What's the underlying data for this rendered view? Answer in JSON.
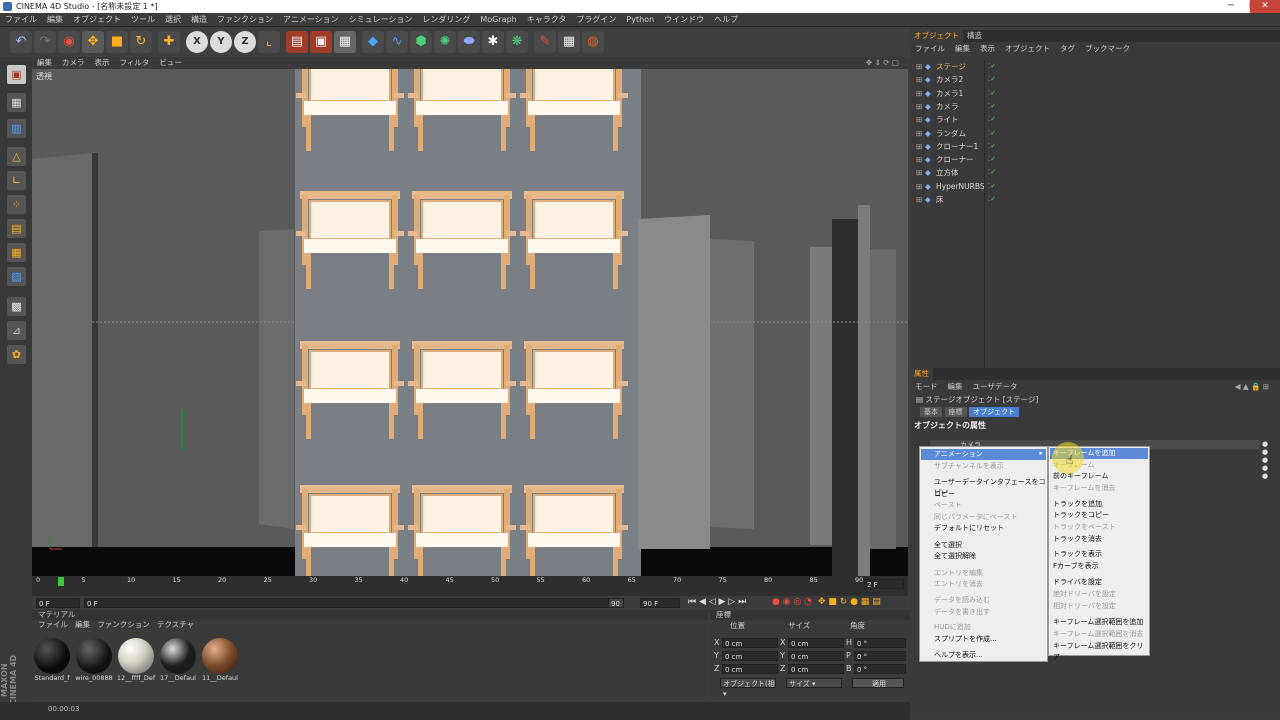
{
  "window": {
    "title": "CINEMA 4D Studio - [名称未設定 1 *]",
    "minimize": "─",
    "maximize": "□",
    "close": "✕"
  },
  "menubar": [
    "ファイル",
    "編集",
    "オブジェクト",
    "ツール",
    "選択",
    "構造",
    "ファンクション",
    "アニメーション",
    "シミュレーション",
    "レンダリング",
    "MoGraph",
    "キャラクタ",
    "プラグイン",
    "Python",
    "ウインドウ",
    "ヘルプ"
  ],
  "toolbar": {
    "icons": [
      "undo-icon",
      "redo-icon",
      "live-selection-icon",
      "move-icon",
      "scale-icon",
      "rotate-icon",
      "add-icon",
      "x-axis-icon",
      "y-axis-icon",
      "z-axis-icon",
      "coordinate-system-icon",
      "render-view-icon",
      "render-picture-viewer-icon",
      "render-settings-icon",
      "cube-icon",
      "spline-icon",
      "nurbs-icon",
      "array-icon",
      "deformer-icon",
      "scene-icon",
      "environment-icon",
      "camera-icon",
      "light-icon"
    ],
    "axis_x": "X",
    "axis_y": "Y",
    "axis_z": "Z"
  },
  "viewport": {
    "menu": [
      "編集",
      "カメラ",
      "表示",
      "フィルタ",
      "ビュー"
    ],
    "label": "透視"
  },
  "timeline": {
    "ticks": [
      "0",
      "5",
      "10",
      "15",
      "20",
      "25",
      "30",
      "35",
      "40",
      "45",
      "50",
      "55",
      "60",
      "65",
      "70",
      "75",
      "80",
      "85",
      "90"
    ],
    "end_frame": "2 F",
    "start_field": "0 F",
    "mid_field": "0 F",
    "max_field": "90 F",
    "range_field": "90 F"
  },
  "materials": {
    "title": "マテリアル",
    "menu": [
      "ファイル",
      "編集",
      "ファンクション",
      "テクスチャ"
    ],
    "items": [
      {
        "name": "Standard_f",
        "color": "#0a0a0a"
      },
      {
        "name": "wire_00888",
        "color": "#111111"
      },
      {
        "name": "12__ffff_Def",
        "color": "#d8d4c8"
      },
      {
        "name": "17__Defaul",
        "color": "#1c1c1c"
      },
      {
        "name": "11__Defaul",
        "color": "#7a4a2a"
      }
    ]
  },
  "coordinates": {
    "title": "座標",
    "headers": [
      "位置",
      "サイズ",
      "角度"
    ],
    "rows": [
      {
        "axis": "X",
        "pos": "0 cm",
        "size": "0 cm",
        "ang_label": "H",
        "ang": "0 °"
      },
      {
        "axis": "Y",
        "pos": "0 cm",
        "size": "0 cm",
        "ang_label": "P",
        "ang": "0 °"
      },
      {
        "axis": "Z",
        "pos": "0 cm",
        "size": "0 cm",
        "ang_label": "B",
        "ang": "0 °"
      }
    ],
    "mode_select": "オブジェクト(相 ▾",
    "size_select": "サイズ ▾",
    "apply": "適用"
  },
  "objects": {
    "tabs": [
      "オブジェクト",
      "構造"
    ],
    "menu": [
      "ファイル",
      "編集",
      "表示",
      "オブジェクト",
      "タグ",
      "ブックマーク"
    ],
    "items": [
      {
        "name": "ステージ",
        "color": "#ffb347"
      },
      {
        "name": "カメラ2",
        "color": "#d8d8d8"
      },
      {
        "name": "カメラ1",
        "color": "#d8d8d8"
      },
      {
        "name": "カメラ",
        "color": "#d8d8d8"
      },
      {
        "name": "ライト",
        "color": "#d8d8d8"
      },
      {
        "name": "ランダム",
        "color": "#d8d8d8"
      },
      {
        "name": "クローナー1",
        "color": "#d8d8d8"
      },
      {
        "name": "クローナー",
        "color": "#d8d8d8"
      },
      {
        "name": "立方体",
        "color": "#d8d8d8"
      },
      {
        "name": "HyperNURBS",
        "color": "#d8d8d8"
      },
      {
        "name": "床",
        "color": "#d8d8d8"
      }
    ]
  },
  "attributes": {
    "tab": "属性",
    "menu": [
      "モード",
      "編集",
      "ユーザデータ"
    ],
    "object_title": "ステージオブジェクト [ステージ]",
    "subtabs": [
      "基本",
      "座標",
      "オブジェクト"
    ],
    "section": "オブジェクトの属性",
    "field_label": "カメラ"
  },
  "context_menu": {
    "items": [
      {
        "label": "アニメーション",
        "state": "sel"
      },
      {
        "label": "サブチャンネルを表示",
        "state": "dis"
      },
      {
        "label": "ユーザーデータインタフェースをコピー",
        "state": ""
      },
      {
        "label": "コピー",
        "state": ""
      },
      {
        "label": "ペースト",
        "state": "dis"
      },
      {
        "label": "同じパラメータにペースト",
        "state": "dis"
      },
      {
        "label": "デフォルトにリセット",
        "state": ""
      },
      {
        "label": "全て選択",
        "state": ""
      },
      {
        "label": "全て選択解除",
        "state": ""
      },
      {
        "label": "エントリを編集",
        "state": "dis"
      },
      {
        "label": "エントリを消去",
        "state": "dis"
      },
      {
        "label": "データを読み込む",
        "state": "dis"
      },
      {
        "label": "データを書き出す",
        "state": "dis"
      },
      {
        "label": "HUDに追加",
        "state": "dis"
      },
      {
        "label": "スプリプトを作成...",
        "state": ""
      },
      {
        "label": "ヘルプを表示...",
        "state": ""
      }
    ]
  },
  "submenu": {
    "items": [
      {
        "label": "キーフレームを追加",
        "state": "sel"
      },
      {
        "label": "キーフレーム",
        "state": "dis"
      },
      {
        "label": "前のキーフレーム",
        "state": ""
      },
      {
        "label": "キーフレームを消去",
        "state": "dis"
      },
      {
        "label": "トラックを追加",
        "state": ""
      },
      {
        "label": "トラックをコピー",
        "state": ""
      },
      {
        "label": "トラックをペースト",
        "state": "dis"
      },
      {
        "label": "トラックを消去",
        "state": ""
      },
      {
        "label": "トラックを表示",
        "state": ""
      },
      {
        "label": "Fカーブを表示",
        "state": ""
      },
      {
        "label": "ドライバを設定",
        "state": ""
      },
      {
        "label": "絶対ドリーバを設定",
        "state": "dis"
      },
      {
        "label": "相対ドリーバを設定",
        "state": "dis"
      },
      {
        "label": "キーフレーム選択範囲を追加",
        "state": ""
      },
      {
        "label": "キーフレーム選択範囲を消去",
        "state": "dis"
      },
      {
        "label": "キーフレーム選択範囲をクリア",
        "state": ""
      }
    ]
  },
  "status": {
    "time": "00:00:03",
    "brand": "MAXON CINEMA 4D"
  }
}
